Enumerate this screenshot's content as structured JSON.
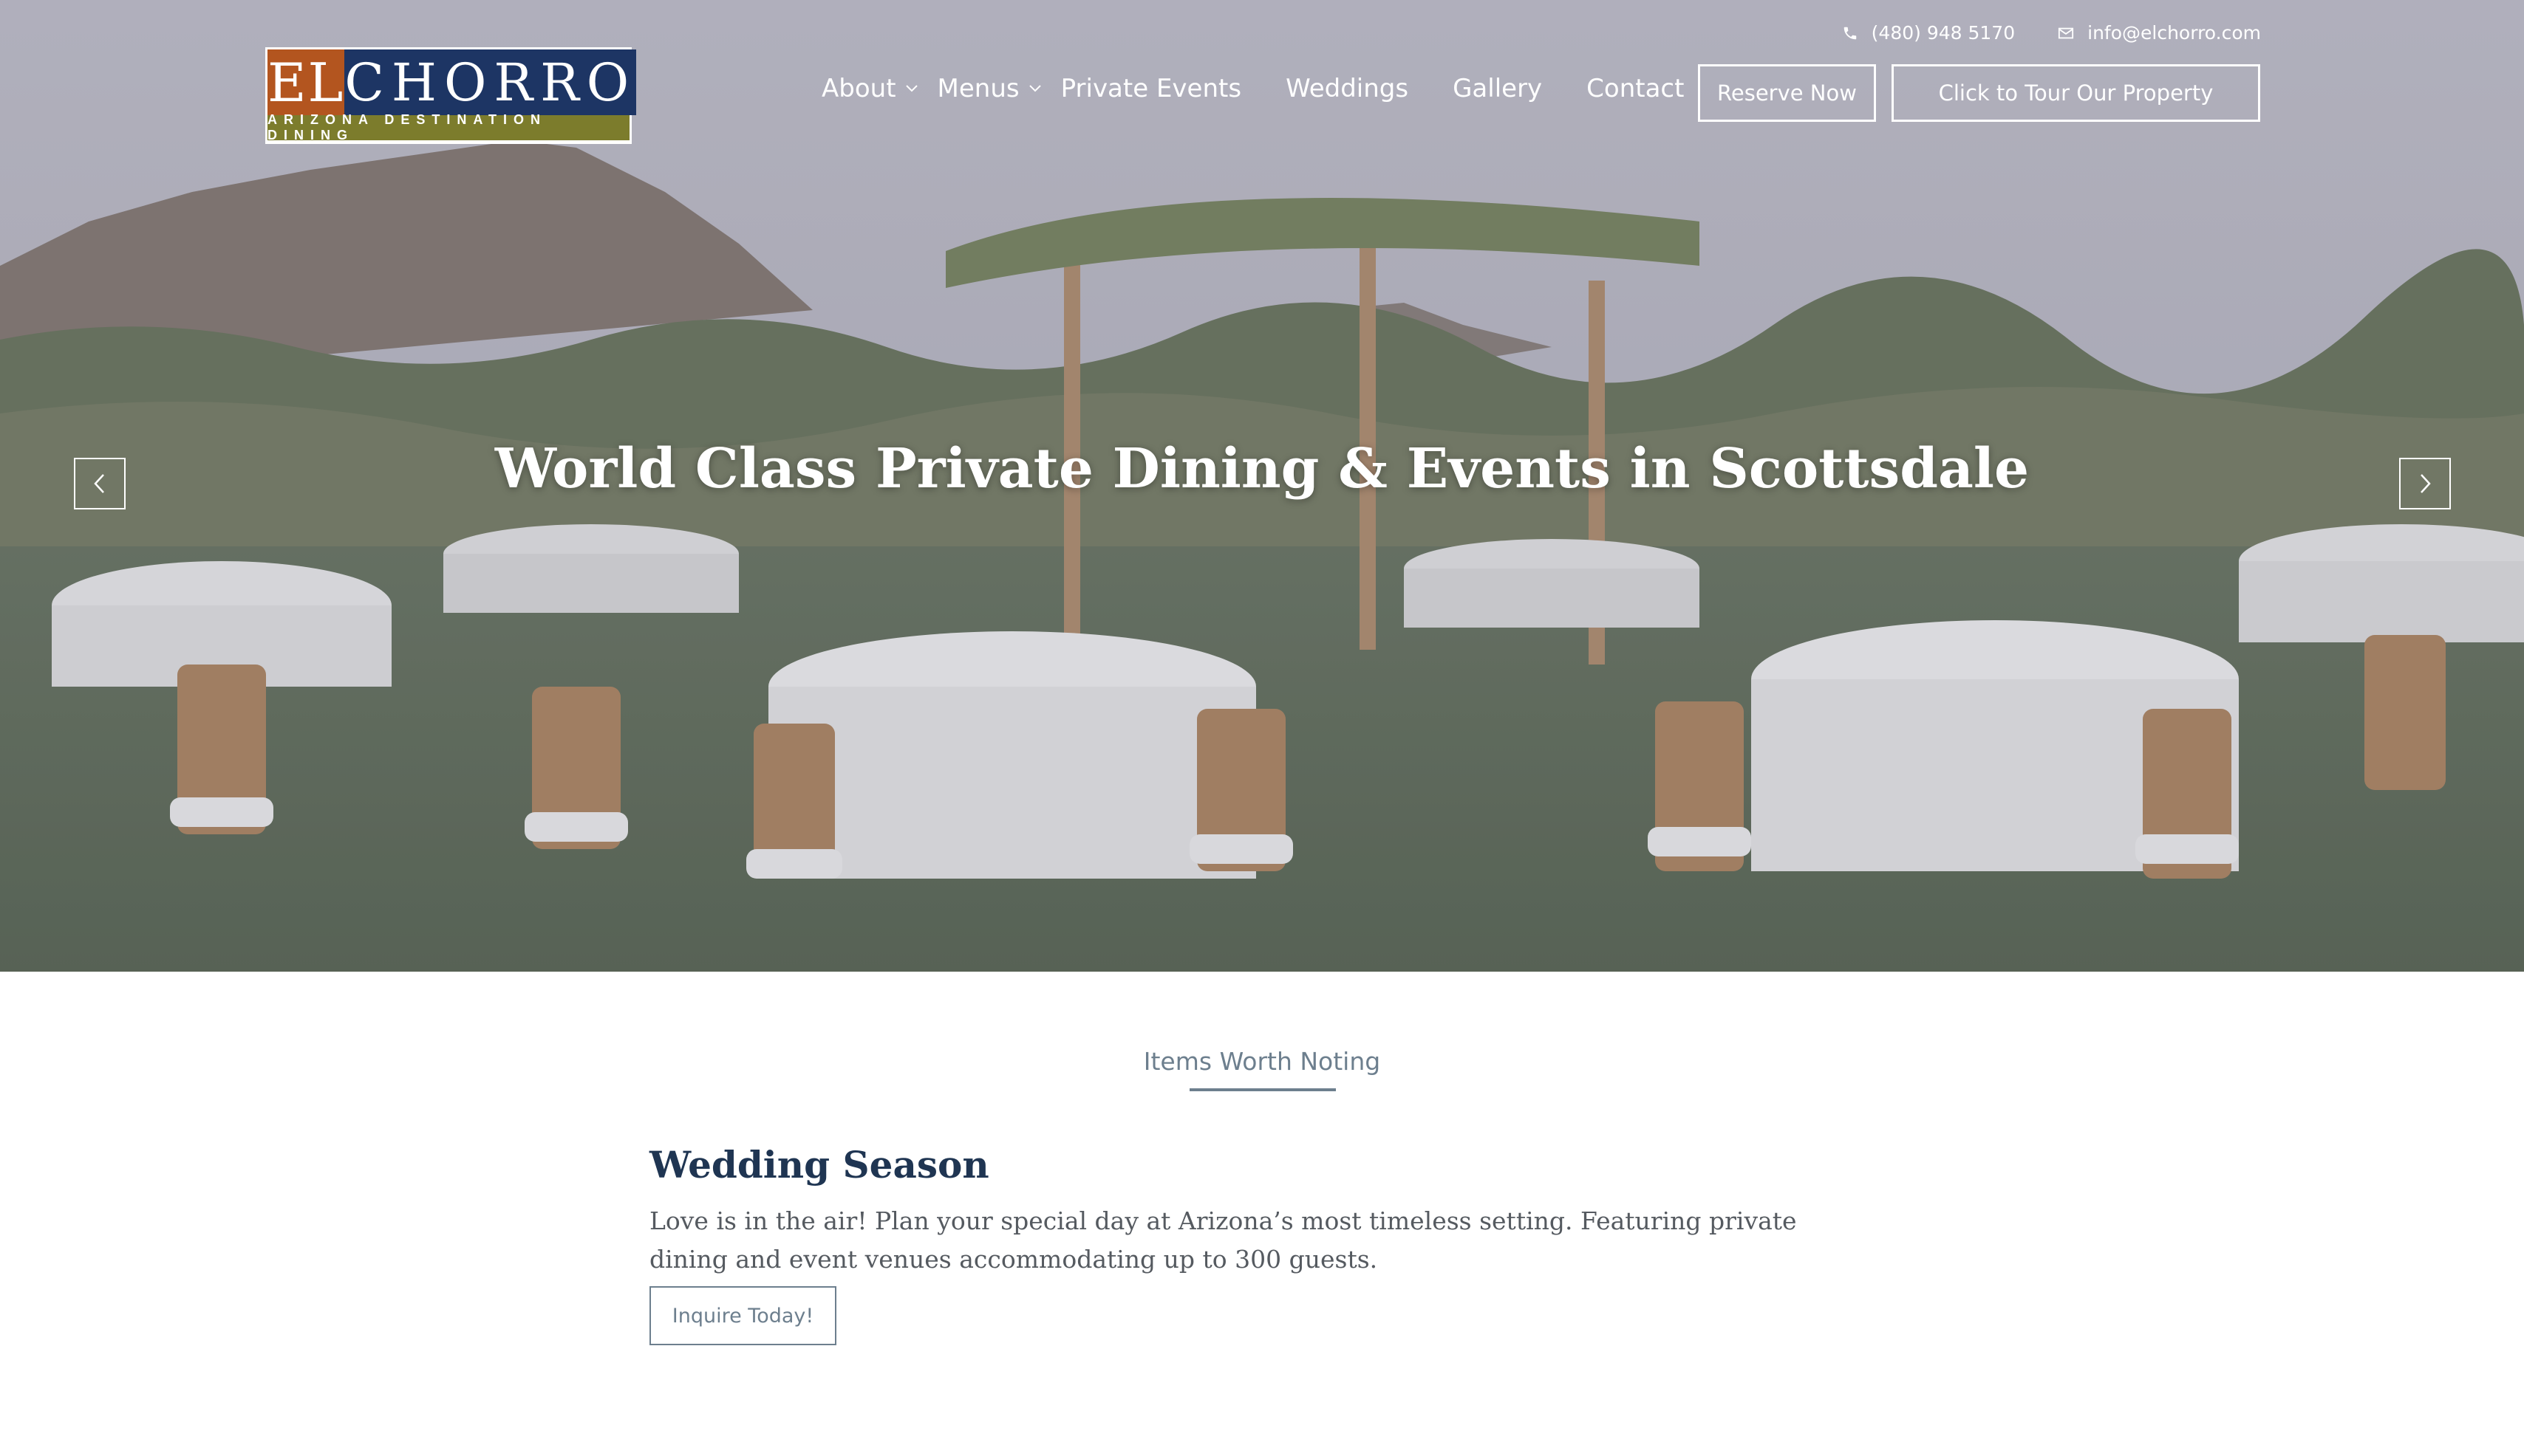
{
  "header": {
    "phone": "(480) 948 5170",
    "email": "info@elchorro.com",
    "logo": {
      "word_left": "EL",
      "word_right": "CHORRO",
      "tagline": "ARIZONA DESTINATION DINING"
    },
    "nav": [
      {
        "label": "About",
        "dropdown": true
      },
      {
        "label": "Menus",
        "dropdown": true
      },
      {
        "label": "Private Events",
        "dropdown": false
      },
      {
        "label": "Weddings",
        "dropdown": false
      },
      {
        "label": "Gallery",
        "dropdown": false
      },
      {
        "label": "Contact",
        "dropdown": false
      }
    ],
    "reserve_label": "Reserve Now",
    "tour_label": "Click to Tour Our Property"
  },
  "hero": {
    "title": "World Class Private Dining & Events in Scottsdale",
    "prev_icon": "chevron-left-icon",
    "next_icon": "chevron-right-icon"
  },
  "notes": {
    "section_label": "Items Worth Noting",
    "title": "Wedding Season",
    "text": "Love is in the air! Plan your special day at Arizona’s most timeless setting. Featuring private dining and event venues accommodating up to 300 guests.",
    "button_label": "Inquire Today!"
  },
  "colors": {
    "logo_orange": "#b3551f",
    "logo_navy": "#1d3564",
    "logo_olive": "#7c7c2c",
    "heading_navy": "#1f3552",
    "accent_slate": "#6d7f8e"
  }
}
